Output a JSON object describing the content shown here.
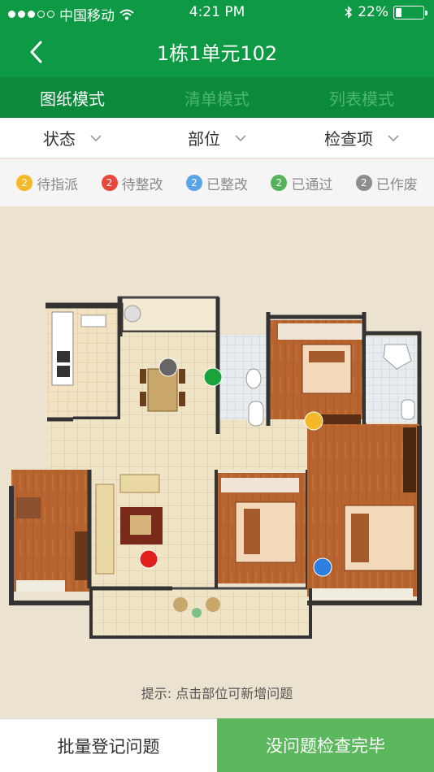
{
  "status_bar": {
    "carrier": "中国移动",
    "time": "4:21 PM",
    "battery": "22%",
    "battery_level": 0.22
  },
  "nav": {
    "title": "1栋1单元102",
    "back_icon": "chevron-left-icon"
  },
  "tabs": [
    {
      "label": "图纸模式",
      "active": true
    },
    {
      "label": "清单模式",
      "active": false
    },
    {
      "label": "列表模式",
      "active": false
    }
  ],
  "filters": [
    {
      "label": "状态"
    },
    {
      "label": "部位"
    },
    {
      "label": "检查项"
    }
  ],
  "legend": [
    {
      "count": "2",
      "label": "待指派",
      "color": "#f5b829"
    },
    {
      "count": "2",
      "label": "待整改",
      "color": "#e9473a"
    },
    {
      "count": "2",
      "label": "已整改",
      "color": "#5aa5ea"
    },
    {
      "count": "2",
      "label": "已通过",
      "color": "#56b35b"
    },
    {
      "count": "2",
      "label": "已作废",
      "color": "#8d8d8d"
    }
  ],
  "markers": [
    {
      "status": "已作废",
      "color": "#666666"
    },
    {
      "status": "已通过",
      "color": "#1aa33a"
    },
    {
      "status": "待指派",
      "color": "#f5b829"
    },
    {
      "status": "待整改",
      "color": "#e0201b"
    },
    {
      "status": "已整改",
      "color": "#2f7fe0"
    }
  ],
  "hint": "提示: 点击部位可新增问题",
  "bottom": {
    "batch_label": "批量登记问题",
    "done_label": "没问题检查完毕"
  }
}
